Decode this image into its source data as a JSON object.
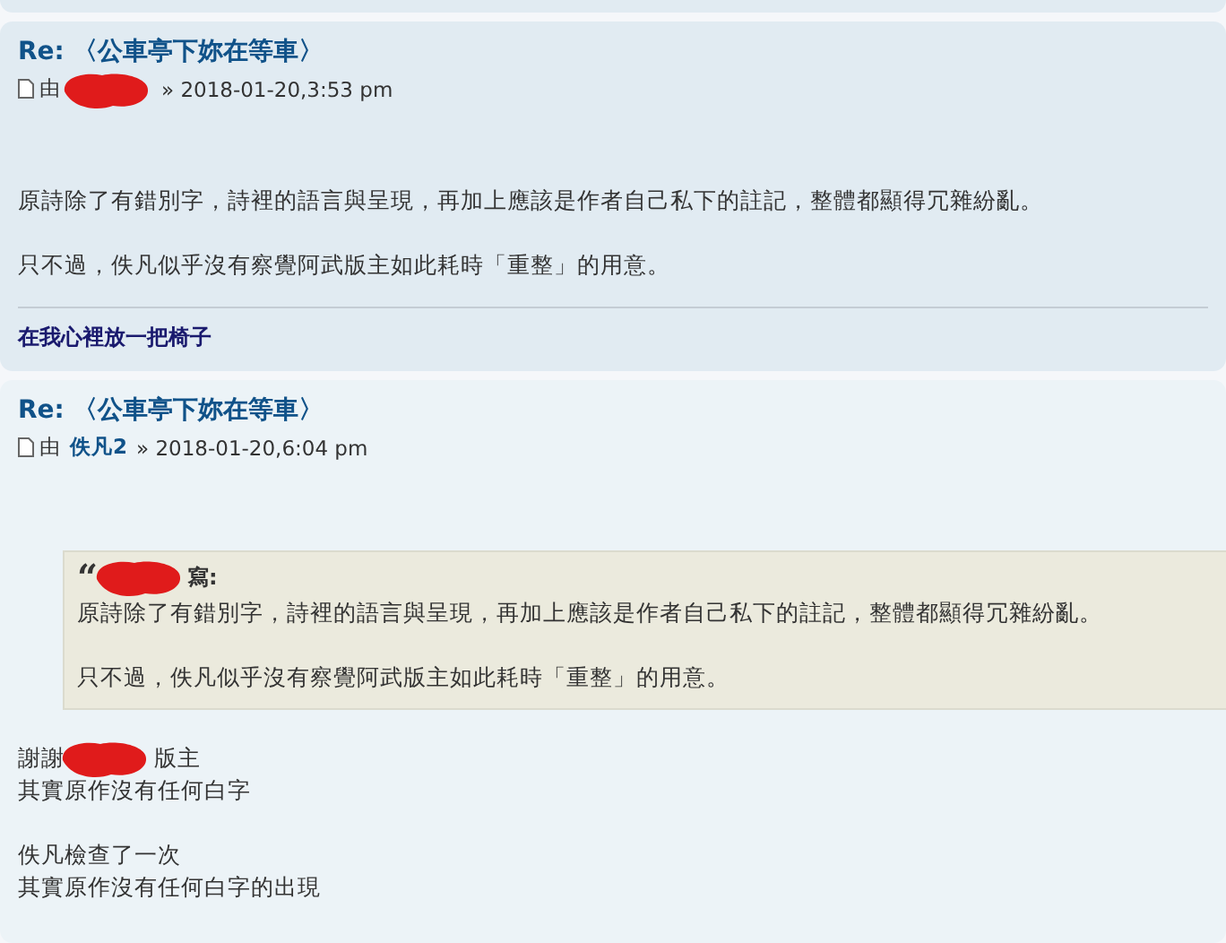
{
  "posts": [
    {
      "title": "Re: 〈公車亭下妳在等車〉",
      "meta": [
        {
          "kind": "text",
          "text": "由"
        },
        {
          "kind": "redacted"
        },
        {
          "kind": "text",
          "text": "» 2018-01-20,3:53 pm"
        }
      ],
      "blocks": [
        {
          "kind": "paragraph",
          "lines": [
            [
              {
                "kind": "text",
                "text": "原詩除了有錯別字，詩裡的語言與呈現，再加上應該是作者自己私下的註記，整體都顯得冗雜紛亂。"
              }
            ]
          ]
        },
        {
          "kind": "paragraph",
          "lines": [
            [
              {
                "kind": "text",
                "text": "只不過，佚凡似乎沒有察覺阿武版主如此耗時「重整」的用意。"
              }
            ]
          ]
        }
      ],
      "signature": "在我心裡放一把椅子"
    },
    {
      "title": "Re: 〈公車亭下妳在等車〉",
      "meta": [
        {
          "kind": "text",
          "text": "由"
        },
        {
          "kind": "link",
          "text": "佚凡2"
        },
        {
          "kind": "text",
          "text": "» 2018-01-20,6:04 pm"
        }
      ],
      "blocks": [
        {
          "kind": "quote",
          "header": [
            {
              "kind": "text",
              "text": "“"
            },
            {
              "kind": "redacted"
            },
            {
              "kind": "text",
              "text": "寫:"
            }
          ],
          "paragraphs": [
            "原詩除了有錯別字，詩裡的語言與呈現，再加上應該是作者自己私下的註記，整體都顯得冗雜紛亂。",
            "只不過，佚凡似乎沒有察覺阿武版主如此耗時「重整」的用意。"
          ]
        },
        {
          "kind": "paragraph",
          "lines": [
            [
              {
                "kind": "text",
                "text": "謝謝"
              },
              {
                "kind": "redacted"
              },
              {
                "kind": "text",
                "text": "版主"
              }
            ],
            [
              {
                "kind": "text",
                "text": "其實原作沒有任何白字"
              }
            ]
          ]
        },
        {
          "kind": "paragraph",
          "lines": [
            [
              {
                "kind": "text",
                "text": "佚凡檢查了一次"
              }
            ],
            [
              {
                "kind": "text",
                "text": "其實原作沒有任何白字的出現"
              }
            ]
          ]
        }
      ]
    }
  ]
}
